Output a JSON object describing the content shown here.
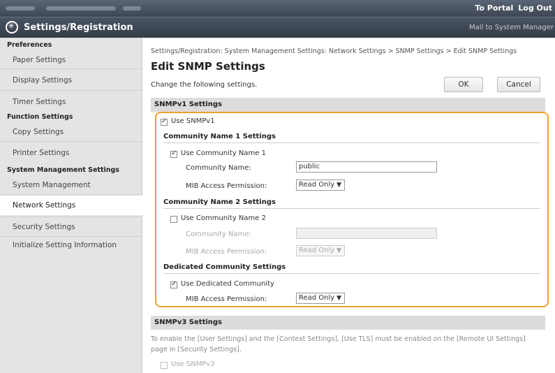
{
  "header": {
    "portal_link": "To Portal",
    "logout_link": "Log Out",
    "app_title": "Settings/Registration",
    "mail_link": "Mail to System Manager"
  },
  "sidebar": {
    "groups": [
      {
        "title": "Preferences",
        "items": [
          "Paper Settings",
          "Display Settings",
          "Timer Settings"
        ]
      },
      {
        "title": "Function Settings",
        "items": [
          "Copy Settings",
          "Printer Settings"
        ]
      },
      {
        "title": "System Management Settings",
        "items": [
          "System Management",
          "Network Settings",
          "Security Settings",
          "Initialize Setting Information"
        ]
      }
    ],
    "selected": "Network Settings"
  },
  "main": {
    "breadcrumb": "Settings/Registration: System Management Settings: Network Settings > SNMP Settings > Edit SNMP Settings",
    "title": "Edit SNMP Settings",
    "instruction": "Change the following settings.",
    "ok_label": "OK",
    "cancel_label": "Cancel",
    "snmpv1": {
      "section_title": "SNMPv1 Settings",
      "use_label": "Use SNMPv1",
      "use_checked": true,
      "community1": {
        "heading": "Community Name 1 Settings",
        "use_label": "Use Community Name 1",
        "use_checked": true,
        "name_label": "Community Name:",
        "name_value": "public",
        "mib_label": "MIB Access Permission:",
        "mib_value": "Read Only"
      },
      "community2": {
        "heading": "Community Name 2 Settings",
        "use_label": "Use Community Name 2",
        "use_checked": false,
        "name_label": "Community Name:",
        "name_value": "",
        "mib_label": "MIB Access Permission:",
        "mib_value": "Read Only"
      },
      "dedicated": {
        "heading": "Dedicated Community Settings",
        "use_label": "Use Dedicated Community",
        "use_checked": true,
        "mib_label": "MIB Access Permission:",
        "mib_value": "Read Only"
      }
    },
    "snmpv3": {
      "section_title": "SNMPv3 Settings",
      "note": "To enable the [User Settings] and the [Context Settings], [Use TLS] must be enabled on the [Remote UI Settings] page in [Security Settings].",
      "use_label": "Use SNMPv3",
      "use_checked": false
    }
  },
  "colors": {
    "highlight": "#f0a030",
    "topbar": "#3d4654"
  }
}
